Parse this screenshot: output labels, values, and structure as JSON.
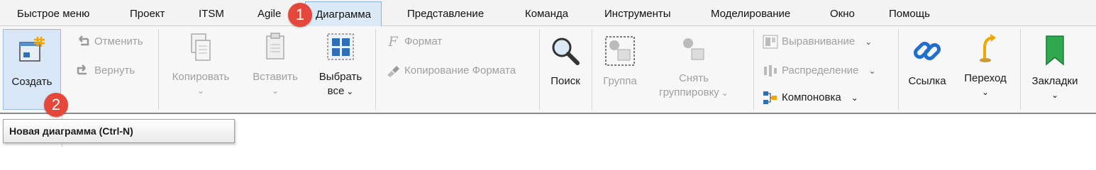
{
  "menu": {
    "items": [
      {
        "key": "quick",
        "label": "Быстрое меню"
      },
      {
        "key": "project",
        "label": "Проект"
      },
      {
        "key": "itsm",
        "label": "ITSM"
      },
      {
        "key": "agile",
        "label": "Agile"
      },
      {
        "key": "diagram",
        "label": "Диаграмма",
        "active": true
      },
      {
        "key": "view",
        "label": "Представление"
      },
      {
        "key": "team",
        "label": "Команда"
      },
      {
        "key": "tools",
        "label": "Инструменты"
      },
      {
        "key": "modeling",
        "label": "Моделирование"
      },
      {
        "key": "window",
        "label": "Окно"
      },
      {
        "key": "help",
        "label": "Помощь"
      }
    ]
  },
  "ribbon": {
    "create": "Создать",
    "undo": "Отменить",
    "redo": "Вернуть",
    "copy": "Копировать",
    "paste": "Вставить",
    "select_all_line1": "Выбрать",
    "select_all_line2": "все",
    "format": "Формат",
    "copy_format": "Копирование Формата",
    "search": "Поиск",
    "group": "Группа",
    "ungroup_line1": "Снять",
    "ungroup_line2": "группировку",
    "align": "Выравнивание",
    "distribute": "Распределение",
    "layout": "Компоновка",
    "link": "Ссылка",
    "goto": "Переход",
    "bookmarks": "Закладки"
  },
  "badges": {
    "one": "1",
    "two": "2"
  },
  "tooltip": {
    "text": "Новая диаграмма (Ctrl-N)"
  },
  "colors": {
    "badge": "#e5483a",
    "active_tab": "#dce9f7",
    "link_icon": "#1f6fd1",
    "bookmark_icon": "#2fa84f"
  }
}
